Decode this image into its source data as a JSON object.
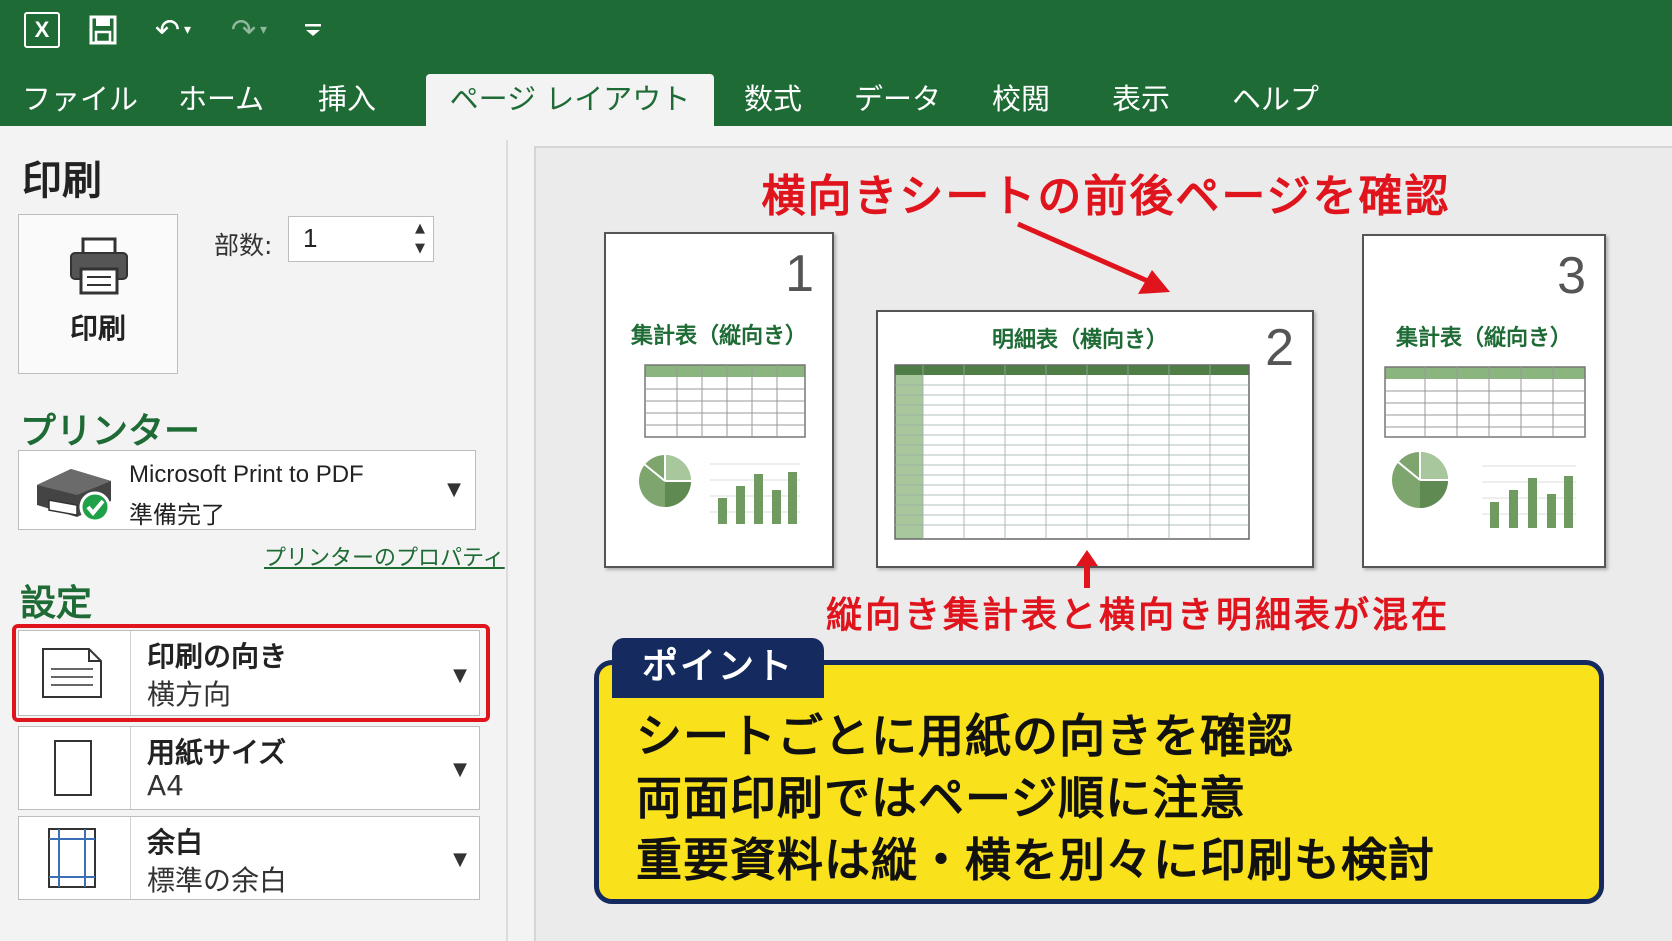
{
  "qat": {
    "app_icon": "excel-icon",
    "save_icon": "save-icon",
    "undo_icon": "undo-icon",
    "redo_icon": "redo-icon",
    "customize_icon": "customize-qat-icon"
  },
  "tabs": [
    {
      "label": "ファイル",
      "active": false
    },
    {
      "label": "ホーム",
      "active": false
    },
    {
      "label": "挿入",
      "active": false
    },
    {
      "label": "ページ レイアウト",
      "active": true
    },
    {
      "label": "数式",
      "active": false
    },
    {
      "label": "データ",
      "active": false
    },
    {
      "label": "校閲",
      "active": false
    },
    {
      "label": "表示",
      "active": false
    },
    {
      "label": "ヘルプ",
      "active": false
    }
  ],
  "print": {
    "heading": "印刷",
    "button_label": "印刷",
    "copies_label": "部数:",
    "copies_value": "1"
  },
  "printer": {
    "heading": "プリンター",
    "name": "Microsoft Print to PDF",
    "status": "準備完了",
    "properties_link": "プリンターのプロパティ"
  },
  "settings": {
    "heading": "設定",
    "orientation": {
      "title": "印刷の向き",
      "value": "横方向"
    },
    "paper_size": {
      "title": "用紙サイズ",
      "value": "A4"
    },
    "margins": {
      "title": "余白",
      "value": "標準の余白"
    }
  },
  "preview": {
    "callout_top": "横向きシートの前後ページを確認",
    "callout_bottom": "縦向き集計表と横向き明細表が混在",
    "pages": [
      {
        "number": "1",
        "title": "集計表（縦向き）",
        "orientation": "portrait"
      },
      {
        "number": "2",
        "title": "明細表（横向き）",
        "orientation": "landscape"
      },
      {
        "number": "3",
        "title": "集計表（縦向き）",
        "orientation": "portrait"
      }
    ]
  },
  "point": {
    "tag": "ポイント",
    "lines": [
      "シートごとに用紙の向きを確認",
      "両面印刷ではページ順に注意",
      "重要資料は縦・横を別々に印刷も検討"
    ]
  },
  "colors": {
    "excel_green": "#1e6b35",
    "highlight_red": "#e0141c",
    "point_yellow": "#f9e21c",
    "point_navy": "#152a5e"
  }
}
